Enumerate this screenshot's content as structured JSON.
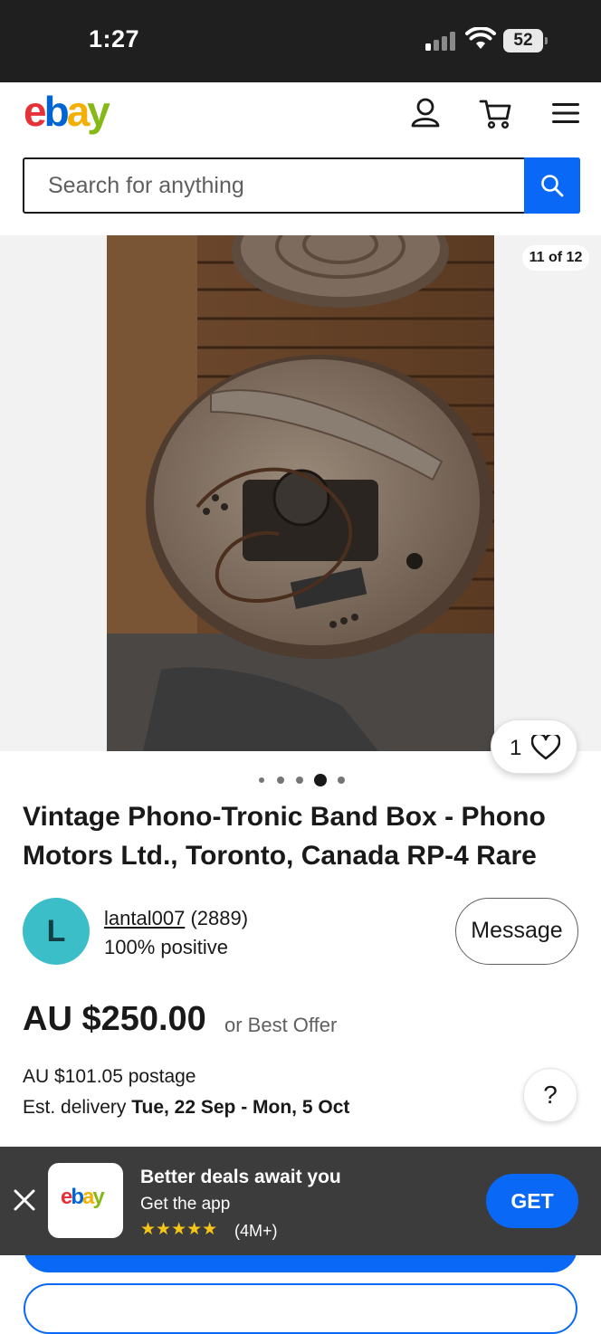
{
  "status_bar": {
    "time": "1:27",
    "battery": "52"
  },
  "header": {
    "logo_letters": [
      "e",
      "b",
      "a",
      "y"
    ]
  },
  "search": {
    "placeholder": "Search for anything"
  },
  "gallery": {
    "counter": "11 of 12",
    "watch_count": "1",
    "dots_total": 5,
    "dots_active_index": 3
  },
  "listing": {
    "title": "Vintage Phono-Tronic Band Box - Phono Motors Ltd., Toronto, Canada RP-4 Rare",
    "seller": {
      "initial": "L",
      "username": "lantal007",
      "feedback_count": "(2889)",
      "positive": "100% positive"
    },
    "message_label": "Message",
    "price": "AU $250.00",
    "offer_text": "or Best Offer",
    "postage": "AU $101.05 postage",
    "delivery_prefix": "Est. delivery ",
    "delivery_dates": "Tue, 22 Sep - Mon, 5 Oct",
    "help_label": "?"
  },
  "app_banner": {
    "app_logo_letters": [
      "e",
      "b",
      "a",
      "y"
    ],
    "title": "Better deals await you",
    "subtitle": "Get the app",
    "stars": "★★★★★",
    "rating_count": "(4M+)",
    "get_label": "GET"
  },
  "colors": {
    "accent": "#0968f6",
    "status_bar": "#1f1f1f",
    "banner": "#3c3c3c",
    "avatar": "#3bbec7"
  }
}
